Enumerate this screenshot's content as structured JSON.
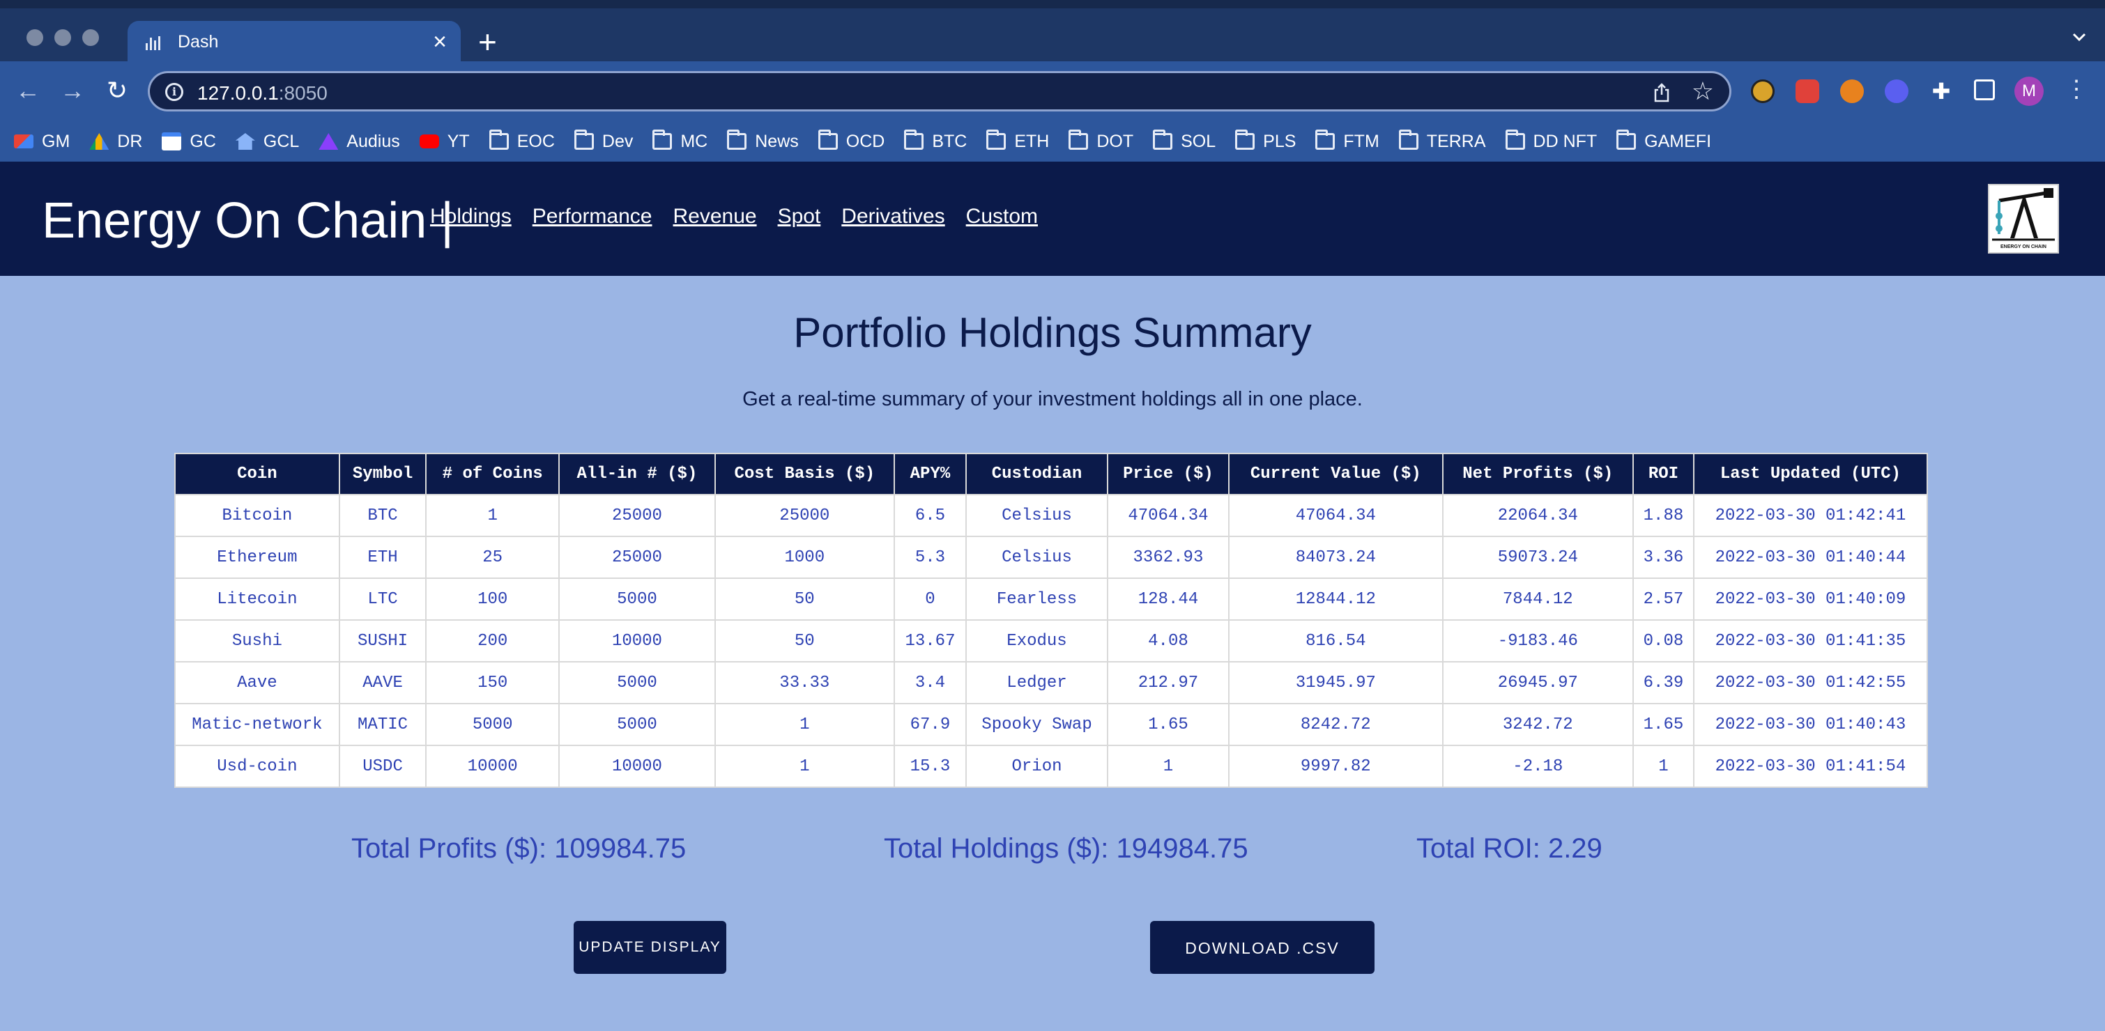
{
  "browser": {
    "tab_title": "Dash",
    "url_host": "127.0.0.1",
    "url_port": ":8050",
    "bookmarks": [
      {
        "label": "GM",
        "icon": "gmail-icon"
      },
      {
        "label": "DR",
        "icon": "drive-icon"
      },
      {
        "label": "GC",
        "icon": "calendar-icon"
      },
      {
        "label": "GCL",
        "icon": "home-icon"
      },
      {
        "label": "Audius",
        "icon": "audius-icon"
      },
      {
        "label": "YT",
        "icon": "youtube-icon"
      },
      {
        "label": "EOC",
        "icon": "folder-icon"
      },
      {
        "label": "Dev",
        "icon": "folder-icon"
      },
      {
        "label": "MC",
        "icon": "folder-icon"
      },
      {
        "label": "News",
        "icon": "folder-icon"
      },
      {
        "label": "OCD",
        "icon": "folder-icon"
      },
      {
        "label": "BTC",
        "icon": "folder-icon"
      },
      {
        "label": "ETH",
        "icon": "folder-icon"
      },
      {
        "label": "DOT",
        "icon": "folder-icon"
      },
      {
        "label": "SOL",
        "icon": "folder-icon"
      },
      {
        "label": "PLS",
        "icon": "folder-icon"
      },
      {
        "label": "FTM",
        "icon": "folder-icon"
      },
      {
        "label": "TERRA",
        "icon": "folder-icon"
      },
      {
        "label": "DD NFT",
        "icon": "folder-icon"
      },
      {
        "label": "GAMEFI",
        "icon": "folder-icon"
      }
    ],
    "profile_initial": "M"
  },
  "header": {
    "brand": "Energy On Chain |",
    "nav": [
      "Holdings",
      "Performance",
      "Revenue",
      "Spot",
      "Derivatives",
      "Custom"
    ],
    "logo_text": "ENERGY ON CHAIN"
  },
  "main": {
    "title": "Portfolio Holdings Summary",
    "subtitle": "Get a real-time summary of your investment holdings all in one place.",
    "table": {
      "columns": [
        "Coin",
        "Symbol",
        "# of Coins",
        "All-in # ($)",
        "Cost Basis ($)",
        "APY%",
        "Custodian",
        "Price ($)",
        "Current Value ($)",
        "Net Profits ($)",
        "ROI",
        "Last Updated (UTC)"
      ],
      "rows": [
        [
          "Bitcoin",
          "BTC",
          "1",
          "25000",
          "25000",
          "6.5",
          "Celsius",
          "47064.34",
          "47064.34",
          "22064.34",
          "1.88",
          "2022-03-30 01:42:41"
        ],
        [
          "Ethereum",
          "ETH",
          "25",
          "25000",
          "1000",
          "5.3",
          "Celsius",
          "3362.93",
          "84073.24",
          "59073.24",
          "3.36",
          "2022-03-30 01:40:44"
        ],
        [
          "Litecoin",
          "LTC",
          "100",
          "5000",
          "50",
          "0",
          "Fearless",
          "128.44",
          "12844.12",
          "7844.12",
          "2.57",
          "2022-03-30 01:40:09"
        ],
        [
          "Sushi",
          "SUSHI",
          "200",
          "10000",
          "50",
          "13.67",
          "Exodus",
          "4.08",
          "816.54",
          "-9183.46",
          "0.08",
          "2022-03-30 01:41:35"
        ],
        [
          "Aave",
          "AAVE",
          "150",
          "5000",
          "33.33",
          "3.4",
          "Ledger",
          "212.97",
          "31945.97",
          "26945.97",
          "6.39",
          "2022-03-30 01:42:55"
        ],
        [
          "Matic-network",
          "MATIC",
          "5000",
          "5000",
          "1",
          "67.9",
          "Spooky Swap",
          "1.65",
          "8242.72",
          "3242.72",
          "1.65",
          "2022-03-30 01:40:43"
        ],
        [
          "Usd-coin",
          "USDC",
          "10000",
          "10000",
          "1",
          "15.3",
          "Orion",
          "1",
          "9997.82",
          "-2.18",
          "1",
          "2022-03-30 01:41:54"
        ]
      ]
    },
    "totals": {
      "profits": "Total Profits ($): 109984.75",
      "holdings": "Total Holdings ($): 194984.75",
      "roi": "Total ROI: 2.29"
    },
    "buttons": {
      "update": "UPDATE DISPLAY",
      "download": "DOWNLOAD .CSV"
    }
  },
  "colors": {
    "header_bg": "#0b1a4a",
    "page_bg": "#9bb5e4",
    "accent_text": "#2e42b3"
  }
}
